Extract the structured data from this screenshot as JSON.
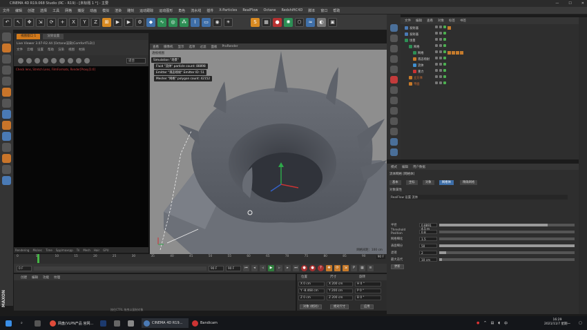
{
  "window": {
    "title": "CINEMA 4D R19.068 Studio (RC - R19) - [未标题 1 *] - 主要"
  },
  "menu": [
    "文件",
    "编辑",
    "创建",
    "选择",
    "工具",
    "网格",
    "捕捉",
    "动画",
    "模拟",
    "渲染",
    "雕刻",
    "运动跟踪",
    "运动图形",
    "角色",
    "流水线",
    "插件",
    "X-Particles",
    "RealFlow",
    "Octane",
    "RedshiftC4D",
    "脚本",
    "窗口",
    "帮助"
  ],
  "picture_viewer": {
    "tabs": [
      "视图窗口 1",
      "渲染设置"
    ],
    "title": "Live Viewer 3.07-R2.44 [Octane渲染(ComfortTLD)]",
    "menu": [
      "文件",
      "云端",
      "设置",
      "帮助",
      "渲染",
      "视图",
      "材质"
    ],
    "zoom": "适合",
    "error_text": "Check lens, Stretch Lens, FilmFormats, Render[Proxy]1:0]",
    "status": [
      "Rendering",
      "Ms/sec",
      "Time",
      "Spp/maxspp",
      "Tri",
      "Mesh",
      "Hair",
      "GPU"
    ]
  },
  "viewport": {
    "menu": [
      "查看",
      "摄像机",
      "显示",
      "选项",
      "过滤",
      "面板",
      "ProRender"
    ],
    "camera_label": "透视视图",
    "sim_lines": [
      "Simulation \"场景\"",
      "Fluid \"流体\" particle count: 88898",
      "Emitter \"液态喷射\" Emitter ID: 51",
      "Mesher \"网格\" polygon count: 42152"
    ],
    "grid_info": "网格间距：100 cm"
  },
  "timeline": {
    "ticks": [
      "0",
      "5",
      "10",
      "15",
      "20",
      "25",
      "30",
      "35",
      "40",
      "45",
      "50",
      "55",
      "60",
      "65",
      "70",
      "75",
      "80",
      "85",
      "90"
    ],
    "end_frame": "90 F",
    "current_frame": "0 F",
    "start_field": "0 F",
    "end_field": "90 F",
    "max_field": "90 F"
  },
  "material_manager": {
    "menu": [
      "创建",
      "编辑",
      "功能",
      "纹理"
    ],
    "status": "按住CTRL 拖曳以复制对象"
  },
  "coordinates": {
    "headers": [
      "位置",
      "尺寸",
      "旋转"
    ],
    "rows": [
      [
        "X  0 cm",
        "X  200 cm",
        "H  0 °"
      ],
      [
        "Y  -8.468 cm",
        "Y  200 cm",
        "P  0 °"
      ],
      [
        "Z  0 cm",
        "Z  200 cm",
        "B  0 °"
      ]
    ],
    "mode_button": "对象 (相对)",
    "size_button": "绝对尺寸",
    "apply_button": "应用"
  },
  "object_manager": {
    "menu": [
      "文件",
      "编辑",
      "查看",
      "对象",
      "标签",
      "书签"
    ],
    "items": [
      {
        "name": "发射器",
        "indent": 0,
        "color": "normal"
      },
      {
        "name": "发射器",
        "indent": 0,
        "color": "normal"
      },
      {
        "name": "场景",
        "indent": 0,
        "color": "normal"
      },
      {
        "name": "网格",
        "indent": 1,
        "color": "normal"
      },
      {
        "name": "网格",
        "indent": 2,
        "color": "normal"
      },
      {
        "name": "液态喷射",
        "indent": 2,
        "color": "normal"
      },
      {
        "name": "流体",
        "indent": 2,
        "color": "normal"
      },
      {
        "name": "重力",
        "indent": 2,
        "color": "normal"
      },
      {
        "name": "立方体",
        "indent": 1,
        "color": "red"
      },
      {
        "name": "平面",
        "indent": 1,
        "color": "red"
      }
    ]
  },
  "attribute_manager": {
    "menu": [
      "模式",
      "编辑",
      "用户数据"
    ],
    "object_name": "流体网格 [网格体]",
    "tabs": [
      "基本",
      "坐标",
      "对象",
      "网格体",
      "精确网格"
    ],
    "section": "对象属性",
    "realflow_row": "RealFlow 设置    流体",
    "rows": [
      {
        "label": "半径",
        "value": "0.8891 4.5 m",
        "fraction": 0.8
      },
      {
        "label": "Threshold Position",
        "value": "0.8",
        "fraction": 0.0
      },
      {
        "label": "网格细化",
        "value": "1.5",
        "fraction": 0.0
      },
      {
        "label": "表面细分",
        "value": "50",
        "fraction": 1.0
      },
      {
        "label": "滤镜",
        "value": "2",
        "fraction": 0.05
      },
      {
        "label": "最大迭代",
        "value": "10 cm",
        "fraction": 0.02
      }
    ],
    "apply_button": "更新"
  },
  "taskbar": {
    "items": [
      "网盘(VLPN产品 官网...",
      "CINEMA 4D R19...",
      "Bandicam"
    ],
    "time": "16:29",
    "date": "2021/11/7 星期一"
  },
  "colors": {
    "accent_orange": "#d37a1b",
    "accent_blue": "#3d6ea8",
    "viewport_bg": "#8e8e8e",
    "playhead_green": "#45b545"
  }
}
